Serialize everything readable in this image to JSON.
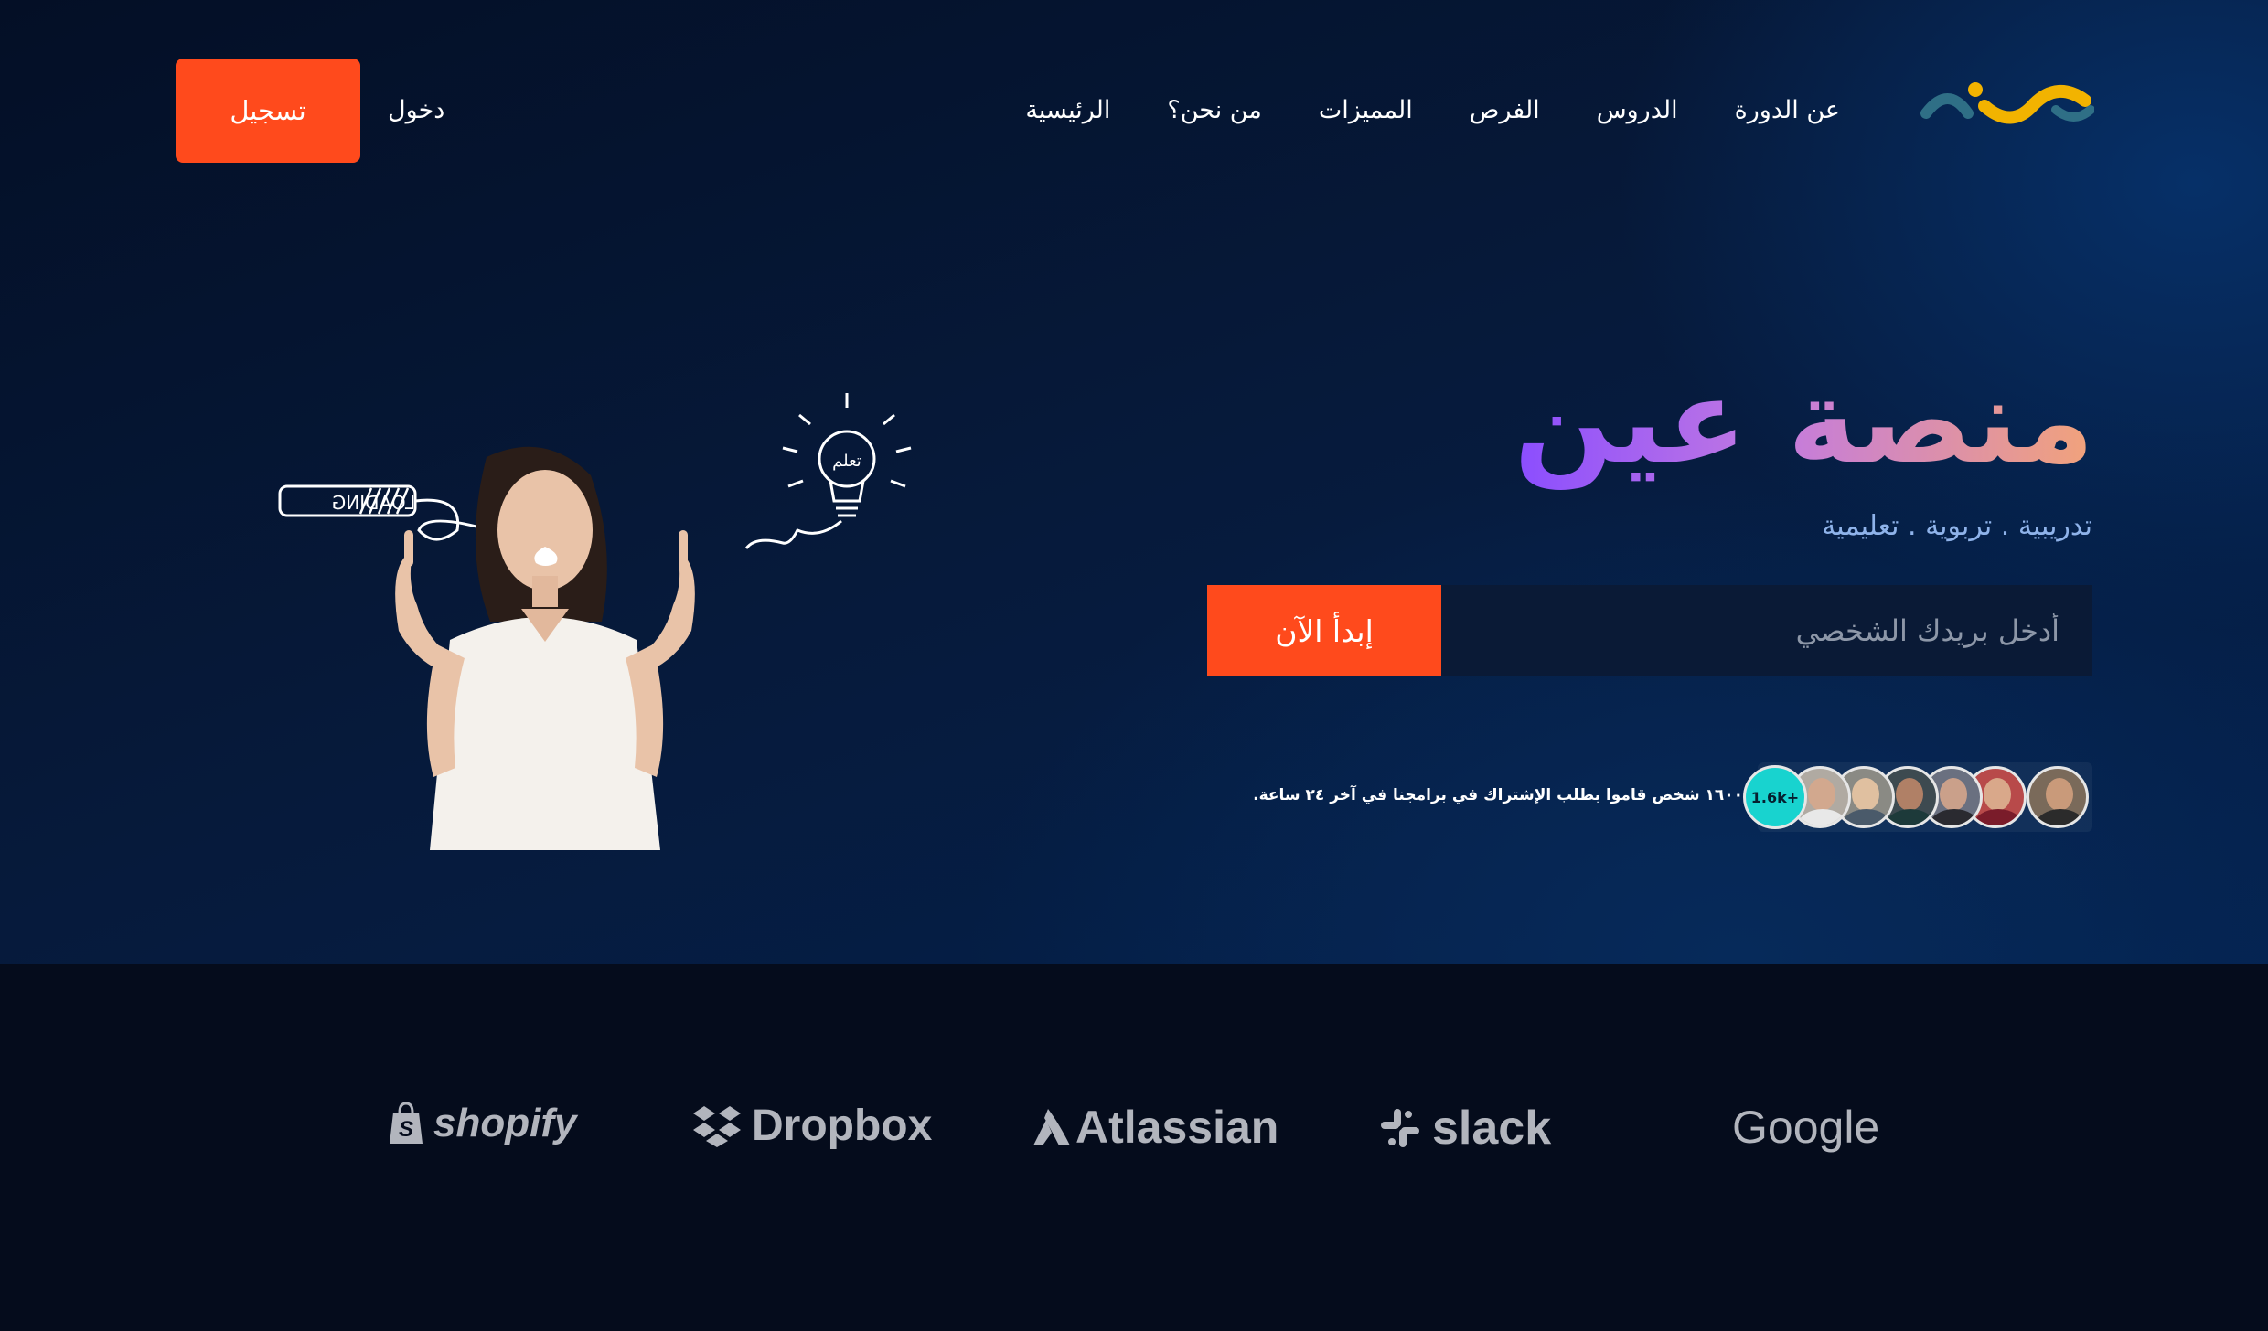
{
  "nav": {
    "items": [
      {
        "label": "الرئيسية"
      },
      {
        "label": "من نحن؟"
      },
      {
        "label": "المميزات"
      },
      {
        "label": "الفرص"
      },
      {
        "label": "الدروس"
      },
      {
        "label": "عن الدورة"
      }
    ],
    "login_label": "دخول",
    "signup_label": "تسجيل"
  },
  "hero": {
    "title": "منصة عين",
    "subtitle": "تدريبية . تربوية . تعليمية",
    "email_placeholder": "أدخل بريدك الشخصي",
    "start_label": "إبدأ الآن",
    "social_proof": "١٦٠٠ شخص قاموا بطلب الإشتراك في برامجنا في آخر ٢٤ ساعة.",
    "count_badge": "1.6k+",
    "illustration": {
      "loading_text": "LOADING",
      "bulb_text": "تعلم"
    }
  },
  "partners": [
    {
      "name": "shopify"
    },
    {
      "name": "Dropbox"
    },
    {
      "name": "Atlassian"
    },
    {
      "name": "slack"
    },
    {
      "name": "Google"
    }
  ],
  "colors": {
    "accent": "#ff4a1c",
    "badge": "#18d3cf",
    "subtitle": "#8fb3ea",
    "logo_teal": "#2f6f86",
    "logo_yellow": "#f2b300"
  }
}
